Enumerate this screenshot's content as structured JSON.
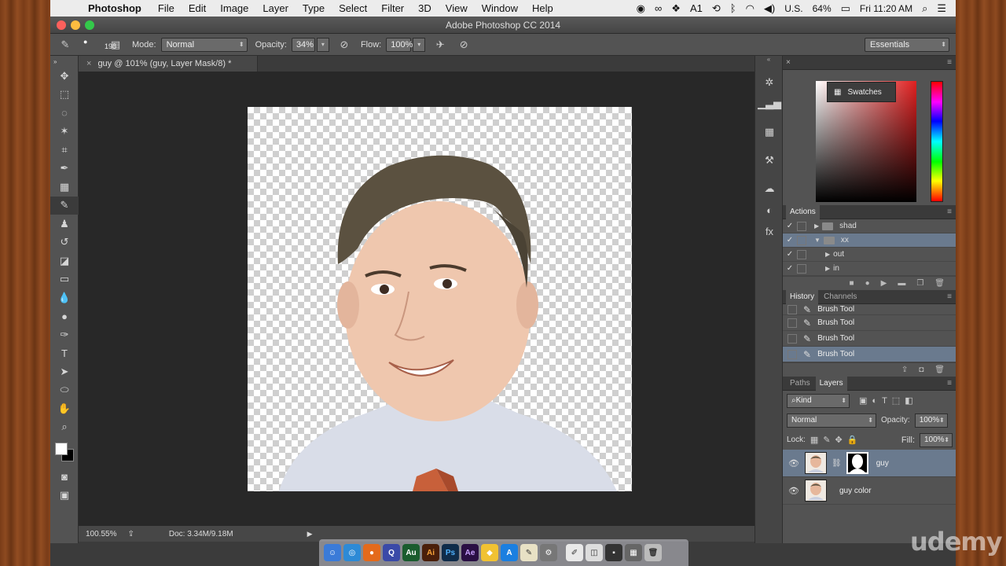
{
  "menubar": {
    "app_name": "Photoshop",
    "items": [
      "File",
      "Edit",
      "Image",
      "Layer",
      "Type",
      "Select",
      "Filter",
      "3D",
      "View",
      "Window",
      "Help"
    ],
    "status": {
      "input_lang": "U.S.",
      "battery": "64%",
      "clock": "Fri 11:20 AM",
      "notif_count": "1"
    }
  },
  "window": {
    "title": "Adobe Photoshop CC 2014"
  },
  "options": {
    "brush_size": "198",
    "mode_label": "Mode:",
    "mode_value": "Normal",
    "opacity_label": "Opacity:",
    "opacity_value": "34%",
    "flow_label": "Flow:",
    "flow_value": "100%",
    "workspace": "Essentials"
  },
  "document": {
    "tab_title": "guy @ 101% (guy, Layer Mask/8) *",
    "zoom": "100.55%",
    "doc_size": "Doc: 3.34M/9.18M"
  },
  "panels": {
    "swatches_label": "Swatches",
    "actions": {
      "tab": "Actions",
      "rows": [
        {
          "label": "shad",
          "indent": 1,
          "expanded": false,
          "folder": true,
          "selected": false
        },
        {
          "label": "xx",
          "indent": 1,
          "expanded": true,
          "folder": true,
          "selected": true
        },
        {
          "label": "out",
          "indent": 2,
          "expanded": false,
          "folder": false,
          "selected": false
        },
        {
          "label": "in",
          "indent": 2,
          "expanded": false,
          "folder": false,
          "selected": false
        }
      ]
    },
    "history": {
      "tabs": [
        "History",
        "Channels"
      ],
      "rows": [
        "Brush Tool",
        "Brush Tool",
        "Brush Tool",
        "Brush Tool"
      ]
    },
    "layers": {
      "tabs": [
        "Paths",
        "Layers"
      ],
      "filter": "Kind",
      "blend": "Normal",
      "opacity_label": "Opacity:",
      "opacity_value": "100%",
      "lock_label": "Lock:",
      "fill_label": "Fill:",
      "fill_value": "100%",
      "rows": [
        {
          "name": "guy",
          "selected": true,
          "has_mask": true
        },
        {
          "name": "guy color",
          "selected": false,
          "has_mask": false
        }
      ]
    }
  },
  "watermark": "udemy",
  "colors": {
    "selection": "#6a7a8e",
    "panel": "#535353",
    "doc_bg": "#282828"
  }
}
